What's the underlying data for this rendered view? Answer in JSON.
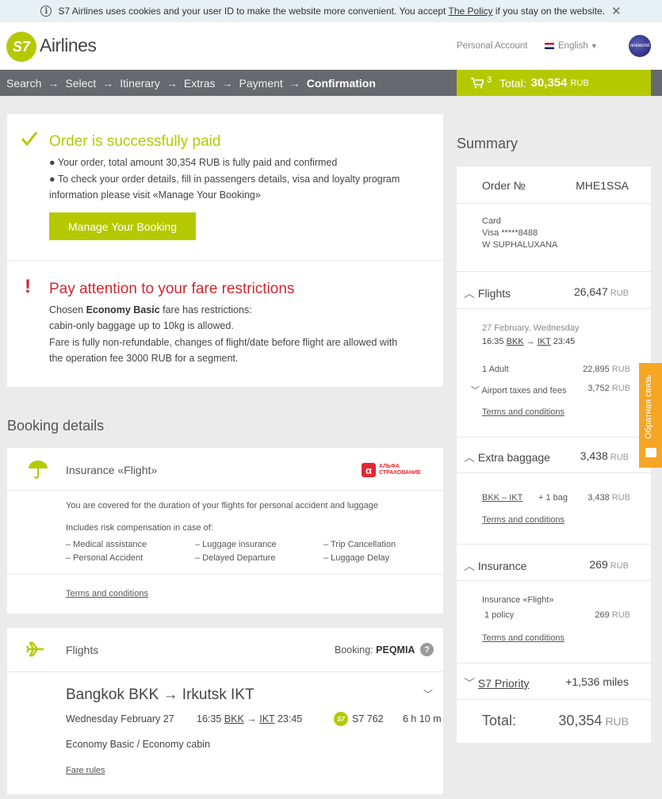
{
  "cookie": {
    "text_before": "S7 Airlines uses cookies and your user ID to make the website more convenient. You accept ",
    "link": "The Policy",
    "text_after": " if you stay on the website."
  },
  "header": {
    "logo_mark": "S7",
    "logo_text": "Airlines",
    "personal_account": "Personal Account",
    "language": "English",
    "oneworld": "oneworld"
  },
  "steps": [
    "Search",
    "Select",
    "Itinerary",
    "Extras",
    "Payment",
    "Confirmation"
  ],
  "cart": {
    "count": "3",
    "label": "Total:",
    "amount": "30,354",
    "currency": "RUB"
  },
  "success": {
    "title": "Order is successfully paid",
    "line1": "Your order, total amount 30,354 RUB is fully paid and confirmed",
    "line2": "To check your order details, fill in passengers details, visa and loyalty program",
    "line3": "information please visit «Manage Your Booking»",
    "button": "Manage Your Booking"
  },
  "attention": {
    "title": "Pay attention to your fare restrictions",
    "chosen_before": "Chosen ",
    "fare": "Economy Basic",
    "chosen_after": " fare has restrictions:",
    "line2": "cabin-only baggage up to 10kg is allowed.",
    "line3": "Fare is fully non-refundable, changes of flight/date before flight are allowed with",
    "line4": "the operation fee 3000 RUB for a segment."
  },
  "booking_details_title": "Booking details",
  "insurance": {
    "title": "Insurance «Flight»",
    "partner_line1": "АЛЬФА",
    "partner_line2": "СТРАХОВАНИЕ",
    "covered": "You are covered for the duration of your flights for personal accident and luggage",
    "includes": "Includes risk compensation in case of:",
    "risks": [
      "– Medical assistance",
      "– Luggage insurance",
      "– Trip Cancellation",
      "– Personal Accident",
      "– Delayed Departure",
      "– Luggage Delay"
    ],
    "terms": "Terms and conditions"
  },
  "flights_card": {
    "title": "Flights",
    "booking_label": "Booking:",
    "booking_code": "PEQMIA",
    "route": "Bangkok BKK → Irkutsk IKT",
    "date": "Wednesday February 27",
    "dep_time": "16:35",
    "dep_code": "BKK",
    "arr_code": "IKT",
    "arr_time": "23:45",
    "flight_no": "S7 762",
    "duration": "6 h 10 m",
    "cabin": "Economy Basic / Economy cabin",
    "fare_rules": "Fare rules"
  },
  "summary": {
    "title": "Summary",
    "order_label": "Order №",
    "order_no": "MHE1SSA",
    "card_label": "Card",
    "card_number": "Visa *****8488",
    "card_holder": "W SUPHALUXANA",
    "flights_label": "Flights",
    "flights_amount": "26,647",
    "flight_date": "27 February, Wednesday",
    "flight_dep": "16:35",
    "flight_from": "BKK",
    "flight_to": "IKT",
    "flight_arr": "23:45",
    "adult_label": "1 Adult",
    "adult_amount": "22,895",
    "taxes_label": "Airport taxes and fees",
    "taxes_amount": "3,752",
    "terms": "Terms and conditions",
    "baggage_label": "Extra baggage",
    "baggage_amount": "3,438",
    "bag_route": "BKK – IKT",
    "bag_qty": "+ 1 bag",
    "bag_amount": "3,438",
    "insurance_label": "Insurance",
    "insurance_amount": "269",
    "ins_name": "Insurance «Flight»",
    "ins_policy": "1 policy",
    "ins_amount": "269",
    "priority_label": "S7 Priority",
    "priority_miles": "+1,536 miles",
    "total_label": "Total:",
    "total_amount": "30,354",
    "currency": "RUB"
  },
  "feedback_tab": "Обратная связь",
  "colors": {
    "brand": "#b5c900",
    "alert": "#d22630",
    "progress_bg": "#66696d",
    "feedback": "#f6a623"
  }
}
